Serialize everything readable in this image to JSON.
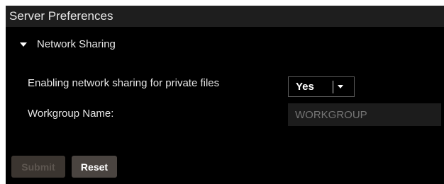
{
  "window": {
    "title": "Server Preferences"
  },
  "network_sharing": {
    "section_label": "Network Sharing",
    "expanded": true,
    "private_files": {
      "label": "Enabling network sharing for private files",
      "selected_value": "Yes"
    },
    "workgroup": {
      "label": "Workgroup Name:",
      "placeholder": "WORKGROUP",
      "value": ""
    }
  },
  "actions": {
    "submit_label": "Submit",
    "submit_enabled": false,
    "reset_label": "Reset"
  },
  "icons": {
    "section_toggle": "triangle-down-icon",
    "select_arrow": "chevron-down-icon"
  },
  "colors": {
    "panel_background": "#000000",
    "titlebar_background": "#1e1e1e",
    "input_background": "#1c1c1c",
    "button_background": "#4a4440",
    "disabled_button_background": "#3b3530"
  }
}
